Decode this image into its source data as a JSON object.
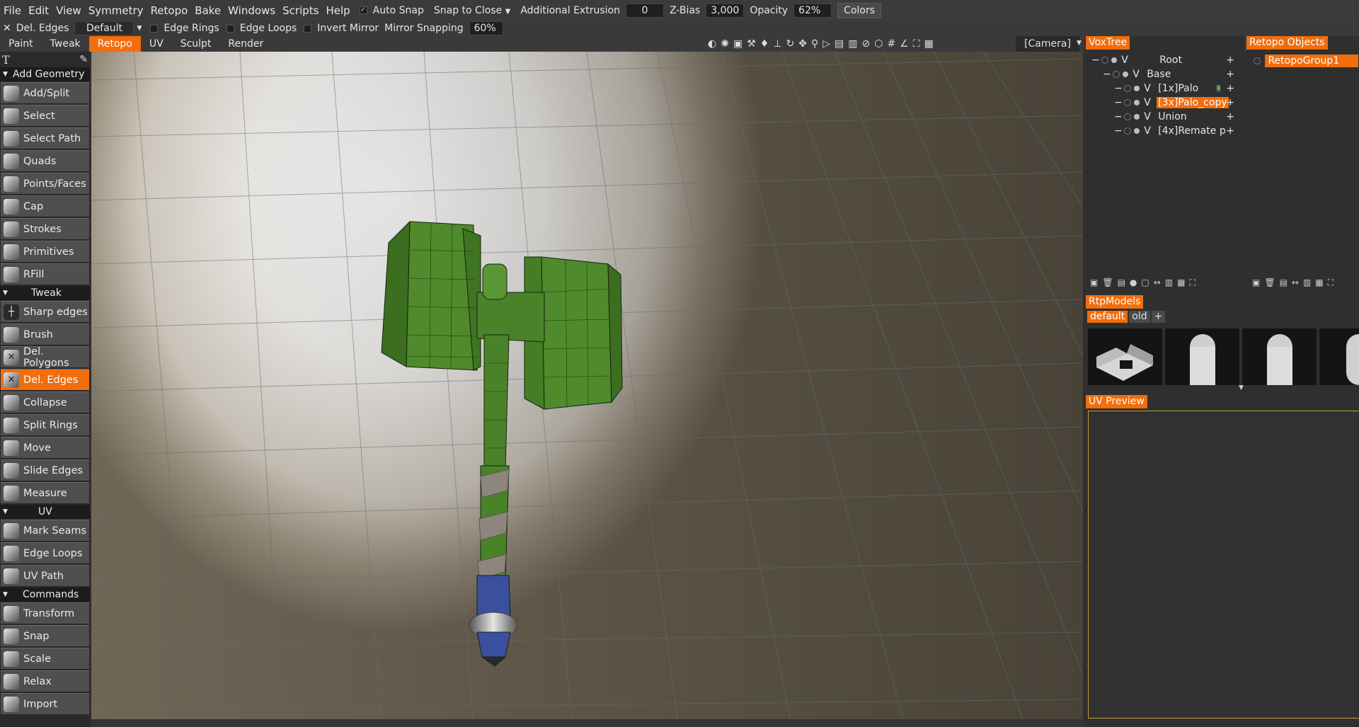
{
  "menubar": {
    "items": [
      "File",
      "Edit",
      "View",
      "Symmetry",
      "Retopo",
      "Bake",
      "Windows",
      "Scripts",
      "Help"
    ],
    "auto_snap_label": "Auto Snap",
    "snap_mode": "Snap to Close",
    "additional_extrusion_label": "Additional Extrusion",
    "additional_extrusion_value": "0",
    "zbias_label": "Z-Bias",
    "zbias_value": "3,000",
    "opacity_label": "Opacity",
    "opacity_value": "62%",
    "colors_button": "Colors"
  },
  "tool_options": {
    "tool_name": "Del. Edges",
    "preset": "Default",
    "edge_rings": "Edge Rings",
    "edge_loops": "Edge Loops",
    "invert_mirror": "Invert Mirror",
    "mirror_snapping_label": "Mirror Snapping",
    "mirror_snapping_value": "60%"
  },
  "room_tabs": [
    "Paint",
    "Tweak",
    "Retopo",
    "UV",
    "Sculpt",
    "Render"
  ],
  "active_room": "Retopo",
  "camera_label": "[Camera]",
  "left_panel": {
    "sections": [
      {
        "title": "Add Geometry",
        "tools": [
          "Add/Split",
          "Select",
          "Select Path",
          "Quads",
          "Points/Faces",
          "Cap",
          "Strokes",
          "Primitives",
          "RFill"
        ]
      },
      {
        "title": "Tweak",
        "tools": [
          "Sharp edges",
          "Brush",
          "Del. Polygons",
          "Del. Edges",
          "Collapse",
          "Split Rings",
          "Move",
          "Slide Edges",
          "Measure"
        ]
      },
      {
        "title": "UV",
        "tools": [
          "Mark Seams",
          "Edge Loops",
          "UV Path"
        ]
      },
      {
        "title": "Commands",
        "tools": [
          "Transform",
          "Snap",
          "Scale",
          "Relax",
          "Import"
        ]
      }
    ],
    "active_tool": "Del. Edges"
  },
  "voxtree": {
    "title": "VoxTree",
    "rows": [
      {
        "prefix": "V",
        "label": "Root"
      },
      {
        "prefix": "V",
        "label": "Base"
      },
      {
        "prefix": "V",
        "label": "[1x]Palo"
      },
      {
        "prefix": "V",
        "label": "[3x]Palo_copy"
      },
      {
        "prefix": "V",
        "label": "Union"
      },
      {
        "prefix": "V",
        "label": "[4x]Remate p"
      }
    ],
    "selected": "[3x]Palo_copy"
  },
  "retopo_objects": {
    "title": "Retopo Objects",
    "items": [
      "RetopoGroup1"
    ]
  },
  "rtpmodels": {
    "title": "RtpModels",
    "tabs": [
      "default",
      "old"
    ],
    "active_tab": "default"
  },
  "uv_preview": {
    "title": "UV Preview"
  },
  "colors": {
    "accent": "#f26d0c",
    "mesh_green": "#4f8a2c",
    "grip_blue": "#3a4f9e"
  }
}
